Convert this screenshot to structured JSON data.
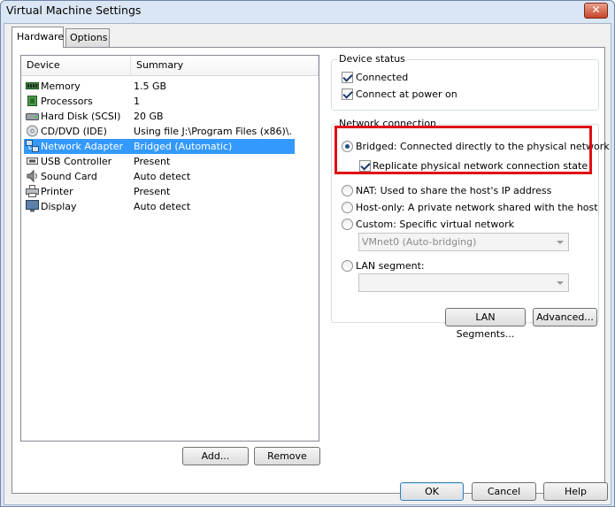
{
  "window": {
    "title": "Virtual Machine Settings",
    "close_glyph": "✕"
  },
  "tabs": [
    {
      "label": "Hardware"
    },
    {
      "label": "Options"
    }
  ],
  "device_list": {
    "headers": {
      "device": "Device",
      "summary": "Summary"
    },
    "rows": [
      {
        "icon": "memory-icon",
        "device": "Memory",
        "summary": "1.5 GB"
      },
      {
        "icon": "processor-icon",
        "device": "Processors",
        "summary": "1"
      },
      {
        "icon": "hard-disk-icon",
        "device": "Hard Disk (SCSI)",
        "summary": "20 GB"
      },
      {
        "icon": "cd-dvd-icon",
        "device": "CD/DVD (IDE)",
        "summary": "Using file J:\\Program Files (x86)\\..."
      },
      {
        "icon": "network-adapter-icon",
        "device": "Network Adapter",
        "summary": "Bridged (Automatic)",
        "selected": true
      },
      {
        "icon": "usb-icon",
        "device": "USB Controller",
        "summary": "Present"
      },
      {
        "icon": "sound-card-icon",
        "device": "Sound Card",
        "summary": "Auto detect"
      },
      {
        "icon": "printer-icon",
        "device": "Printer",
        "summary": "Present"
      },
      {
        "icon": "display-icon",
        "device": "Display",
        "summary": "Auto detect"
      }
    ],
    "add_label": "Add...",
    "remove_label": "Remove"
  },
  "device_status": {
    "title": "Device status",
    "connected": {
      "label": "Connected",
      "checked": true
    },
    "connect_at_power_on": {
      "label": "Connect at power on",
      "checked": true
    }
  },
  "network_connection": {
    "title": "Network connection",
    "bridged": {
      "label": "Bridged: Connected directly to the physical network",
      "selected": true
    },
    "replicate": {
      "label": "Replicate physical network connection state",
      "checked": true
    },
    "nat": {
      "label": "NAT: Used to share the host's IP address",
      "selected": false
    },
    "host_only": {
      "label": "Host-only: A private network shared with the host",
      "selected": false
    },
    "custom": {
      "label": "Custom: Specific virtual network",
      "selected": false
    },
    "custom_select_value": "VMnet0 (Auto-bridging)",
    "lan_segment": {
      "label": "LAN segment:",
      "selected": false
    },
    "lan_segment_select_value": ""
  },
  "buttons": {
    "lan_segments": "LAN Segments...",
    "advanced": "Advanced...",
    "ok": "OK",
    "cancel": "Cancel",
    "help": "Help"
  },
  "colors": {
    "highlight": "#e00d14",
    "selection": "#3399ff"
  }
}
